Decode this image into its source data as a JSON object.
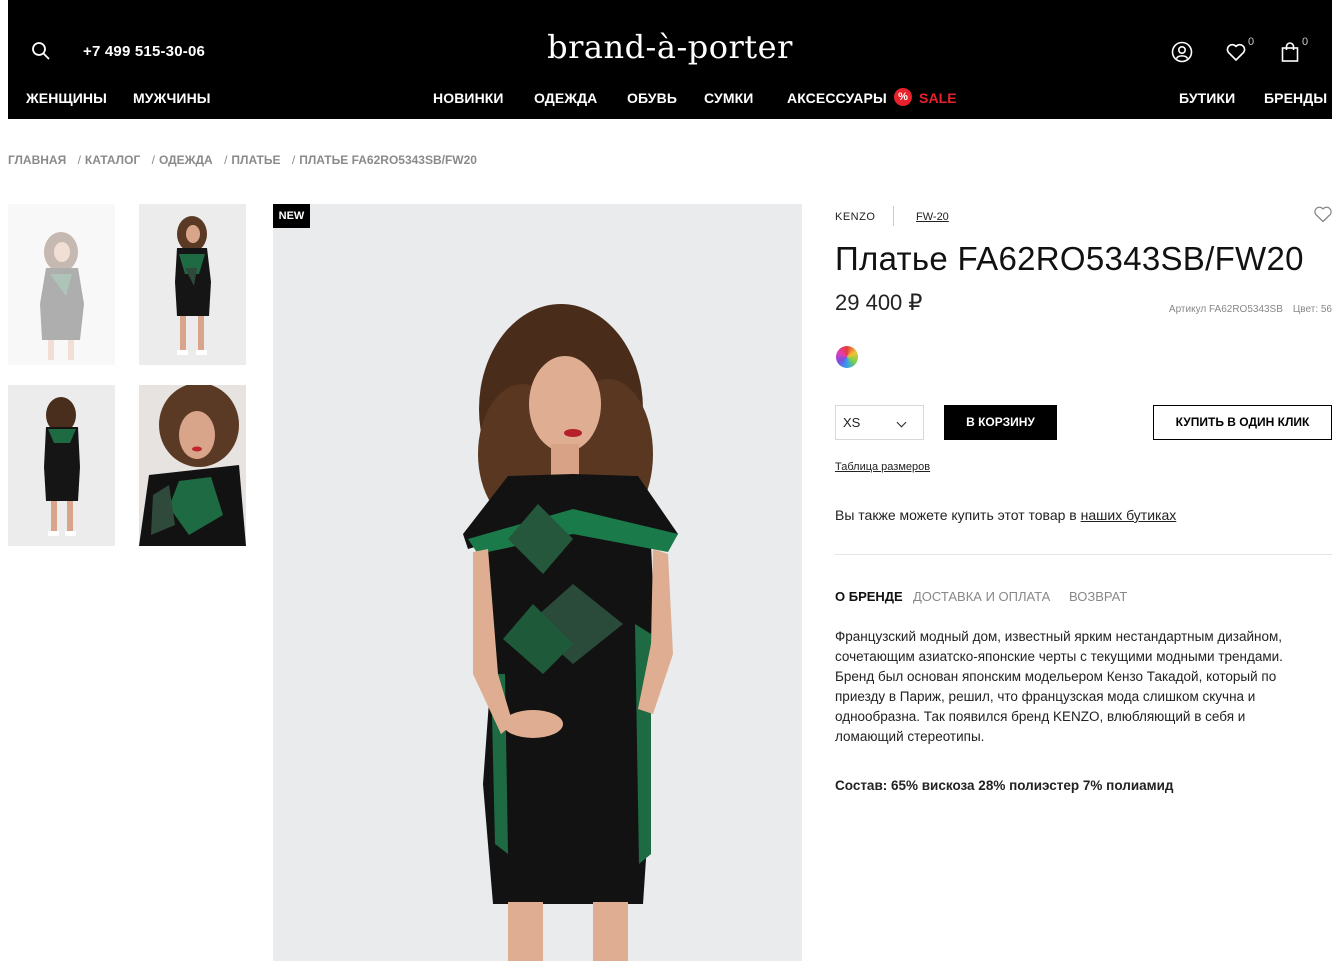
{
  "header": {
    "phone": "+7 499 515-30-06",
    "logo": "brand-à-porter",
    "wishlist_count": "0",
    "cart_count": "0",
    "nav_left": [
      "ЖЕНЩИНЫ",
      "МУЖЧИНЫ"
    ],
    "nav_center": [
      "НОВИНКИ",
      "ОДЕЖДА",
      "ОБУВЬ",
      "СУМКИ",
      "АКСЕССУАРЫ"
    ],
    "sale_icon": "%",
    "sale": "SALE",
    "nav_right": [
      "БУТИКИ",
      "БРЕНДЫ"
    ],
    "icons": [
      "search-icon",
      "user-icon",
      "heart-icon",
      "bag-icon"
    ],
    "sale_color": "#e8212a"
  },
  "breadcrumb": [
    "ГЛАВНАЯ",
    "КАТАЛОГ",
    "ОДЕЖДА",
    "ПЛАТЬЕ",
    "ПЛАТЬЕ FA62RO5343SB/FW20"
  ],
  "breadcrumb_separator": "/",
  "gallery": {
    "badge": "NEW"
  },
  "product": {
    "brand": "KENZO",
    "season": "FW-20",
    "title": "Платье FA62RO5343SB/FW20",
    "price": "29 400 ₽",
    "article": "Артикул FA62RO5343SB",
    "color": "Цвет: 56",
    "size": "XS",
    "cart_button": "В КОРЗИНУ",
    "one_click_button": "КУПИТЬ В ОДИН КЛИК",
    "size_table": "Таблица размеров",
    "boutiques_text": "Вы также можете купить этот товар в ",
    "boutiques_link": "наших бутиках"
  },
  "tabs": [
    "О БРЕНДЕ",
    "ДОСТАВКА И ОПЛАТА",
    "ВОЗВРАТ"
  ],
  "description": "Французский модный дом, известный ярким нестандартным дизайном, сочетающим азиатско-японские черты с текущими модными трендами. Бренд был основан японским модельером Кензо Такадой, который по приезду в Париж, решил, что французская мода слишком скучна и однообразна. Так появился бренд KENZO, влюбляющий в себя и ломающий стереотипы.",
  "composition": "Состав: 65% вискоза 28% полиэстер 7% полиамид"
}
